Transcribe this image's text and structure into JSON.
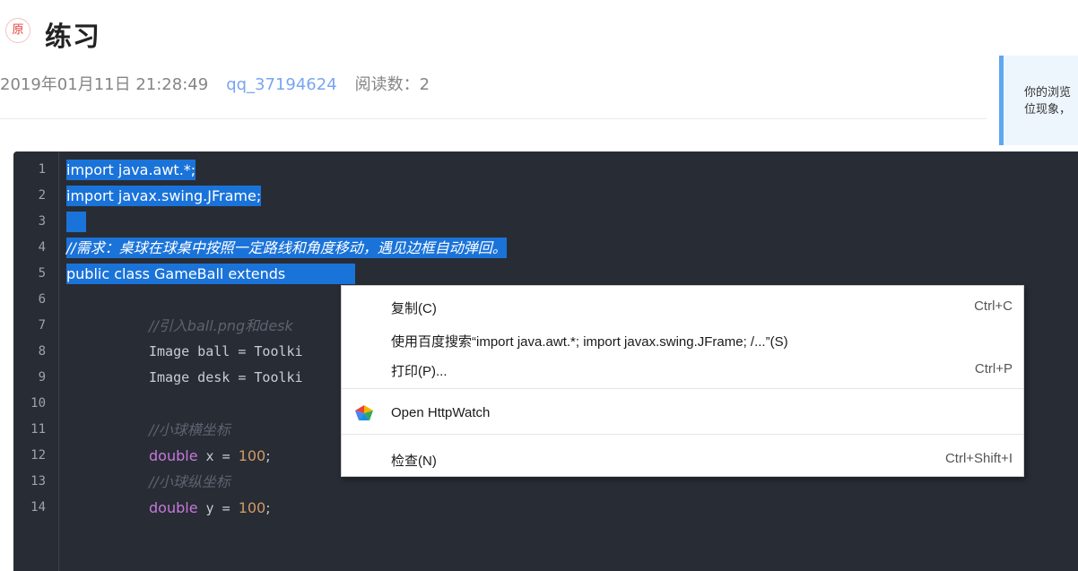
{
  "header": {
    "badge": "原",
    "title": "练习",
    "date": "2019年01月11日 21:28:49",
    "author": "qq_37194624",
    "reads": "阅读数：2"
  },
  "notice": {
    "line1": "你的浏览",
    "line2": "位现象，"
  },
  "code": {
    "lines": [
      "import java.awt.*;",
      "import javax.swing.JFrame;",
      "",
      "//需求：桌球在球桌中按照一定路线和角度移动，遇见边框自动弹回。",
      "public class GameBall extends",
      "",
      "//引入ball.png和desk",
      "Image ball = Toolki",
      "Image desk = Toolki",
      "",
      "//小球横坐标",
      "double x = 100;",
      "//小球纵坐标",
      "double y = 100;"
    ],
    "line_numbers": [
      "1",
      "2",
      "3",
      "4",
      "5",
      "6",
      "7",
      "8",
      "9",
      "10",
      "11",
      "12",
      "13",
      "14"
    ],
    "double_kw": "double",
    "x_var": " x = ",
    "y_var": " y = ",
    "num_100": "100",
    "semicolon": ";"
  },
  "context_menu": {
    "copy": "复制(C)",
    "copy_shortcut": "Ctrl+C",
    "search": "使用百度搜索“import java.awt.*; import javax.swing.JFrame;   /...”(S)",
    "print": "打印(P)...",
    "print_shortcut": "Ctrl+P",
    "httpwatch": "Open HttpWatch",
    "inspect": "检查(N)",
    "inspect_shortcut": "Ctrl+Shift+I"
  },
  "colors": {
    "code_bg": "#282c34",
    "selection": "#1a73d9",
    "keyword": "#c678dd",
    "number": "#d19a66",
    "comment": "#5c6370",
    "author_link": "#78a5f1"
  }
}
